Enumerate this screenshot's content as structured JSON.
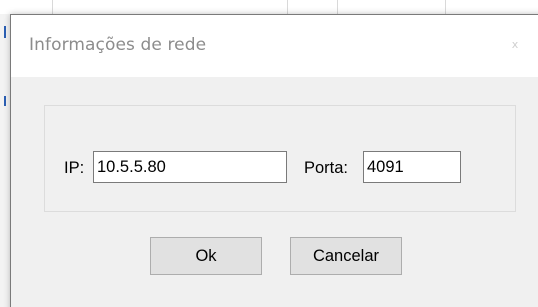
{
  "dialog": {
    "title": "Informações de rede",
    "close_glyph": "x"
  },
  "network": {
    "ip_label": "IP:",
    "ip_value": "10.5.5.80",
    "port_label": "Porta:",
    "port_value": "4091"
  },
  "buttons": {
    "ok_label": "Ok",
    "cancel_label": "Cancelar"
  }
}
